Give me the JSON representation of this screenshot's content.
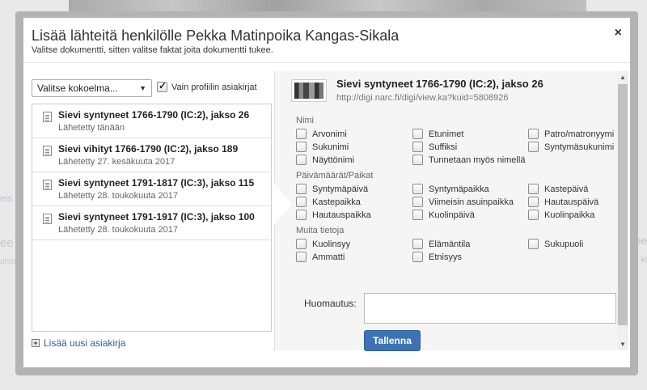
{
  "background": {
    "left_snippets": [
      "eis",
      "ee",
      "ahto"
    ],
    "right_snippets": [
      "ee",
      "ki"
    ]
  },
  "modal": {
    "title": "Lisää lähteitä henkilölle Pekka Matinpoika Kangas-Sikala",
    "subtitle": "Valitse dokumentti, sitten valitse faktat joita dokumentti tukee.",
    "close_label": "×"
  },
  "left": {
    "collection_select": "Valitse kokoelma...",
    "profile_only_label": "Vain profiilin asiakirjat",
    "profile_only_checked": true,
    "documents": [
      {
        "title": "Sievi syntyneet 1766-1790 (IC:2), jakso 26",
        "date": "Lähetetty tänään"
      },
      {
        "title": "Sievi vihityt 1766-1790 (IC:2), jakso 189",
        "date": "Lähetetty 27. kesäkuuta 2017"
      },
      {
        "title": "Sievi syntyneet 1791-1817 (IC:3), jakso 115",
        "date": "Lähetetty 28. toukokuuta 2017"
      },
      {
        "title": "Sievi syntyneet 1791-1917 (IC:3), jakso 100",
        "date": "Lähetetty 28. toukokuuta 2017"
      }
    ],
    "add_document_label": "Lisää uusi asiakirja"
  },
  "right": {
    "source_title": "Sievi syntyneet 1766-1790 (IC:2), jakso 26",
    "source_url": "http://digi.narc.fi/digi/view.ka?kuid=5808926",
    "sections": {
      "nimi": {
        "label": "Nimi",
        "facts": [
          "Arvonimi",
          "Etunimet",
          "Patro/matronyymi",
          "Sukunimi",
          "Suffiksi",
          "Syntymäsukunimi",
          "Näyttönimi",
          "Tunnetaan myös nimellä"
        ]
      },
      "dates": {
        "label": "Päivämäärät/Paikat",
        "facts": [
          "Syntymäpäivä",
          "Syntymäpaikka",
          "Kastepäivä",
          "Kastepaikka",
          "Viimeisin asuinpaikka",
          "Hautauspäivä",
          "Hautauspaikka",
          "Kuolinpäivä",
          "Kuolinpaikka"
        ]
      },
      "other": {
        "label": "Muita tietoja",
        "facts": [
          "Kuolinsyy",
          "Elämäntila",
          "Sukupuoli",
          "Ammatti",
          "Etnisyys"
        ]
      }
    },
    "notes_label": "Huomautus:",
    "save_label": "Tallenna"
  }
}
